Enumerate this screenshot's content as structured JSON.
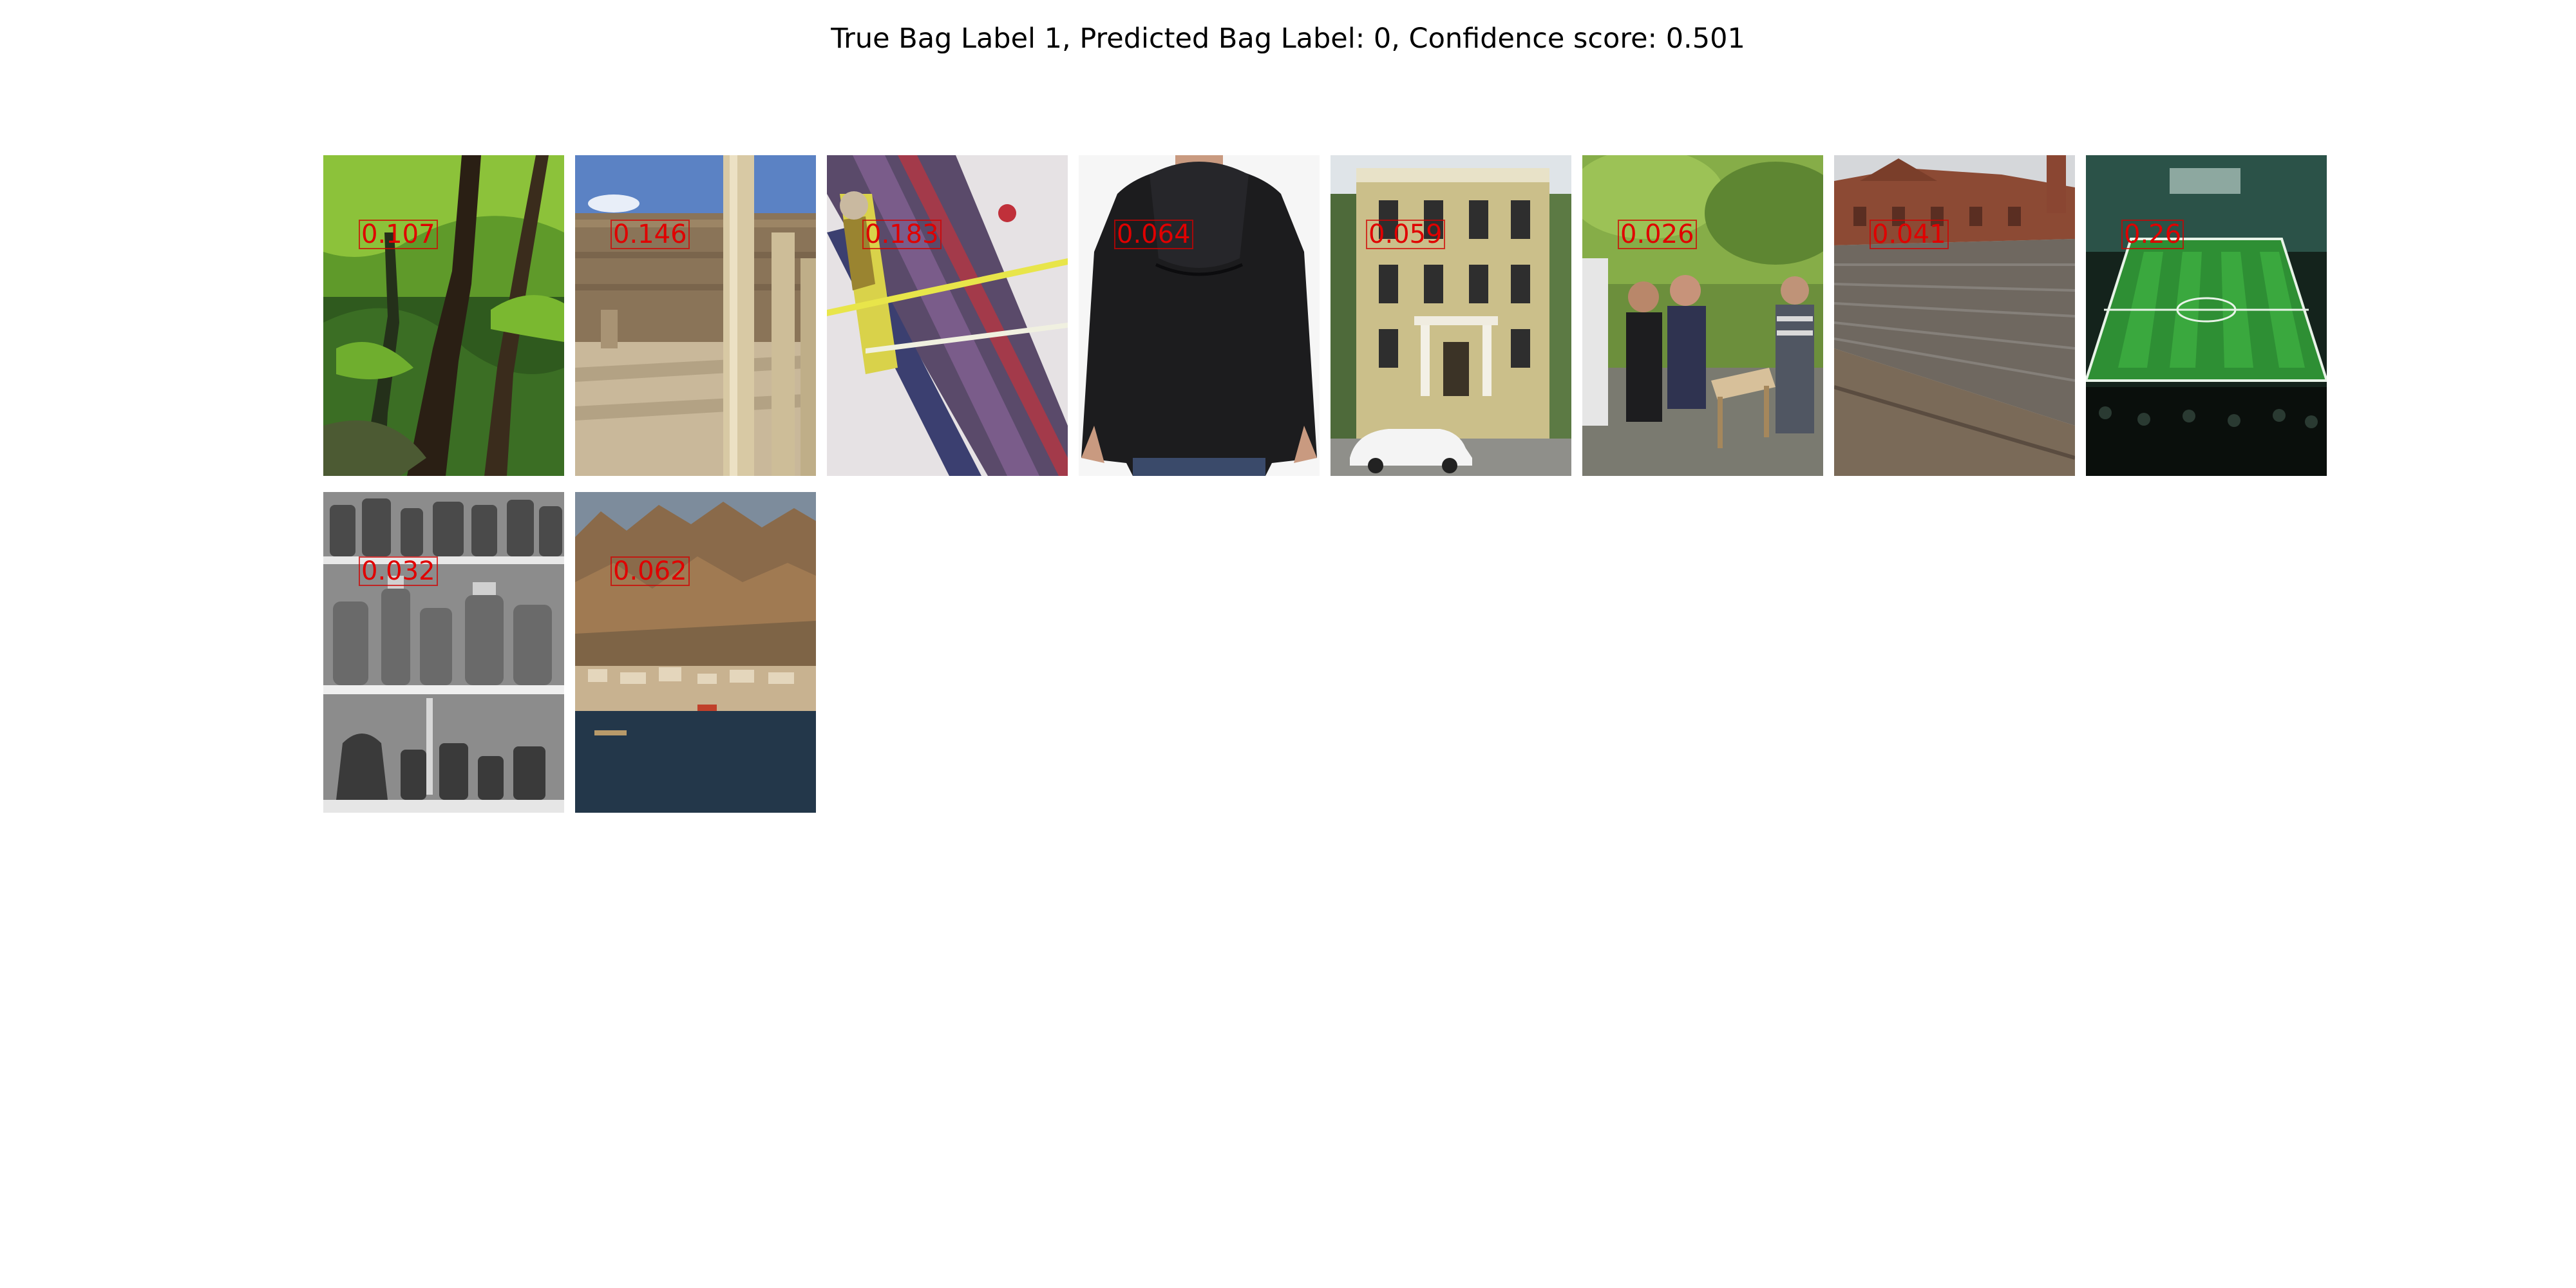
{
  "title": "True Bag Label 1, Predicted Bag Label: 0, Confidence score: 0.501",
  "colors": {
    "score_text": "#e00000",
    "score_box": "#d00000"
  },
  "instances": [
    {
      "score": "0.107",
      "icon": "forest-photo"
    },
    {
      "score": "0.146",
      "icon": "ruins-columns-photo"
    },
    {
      "score": "0.183",
      "icon": "graffiti-art-photo"
    },
    {
      "score": "0.064",
      "icon": "black-hoodie-photo"
    },
    {
      "score": "0.059",
      "icon": "townhouse-photo"
    },
    {
      "score": "0.026",
      "icon": "people-outdoors-photo"
    },
    {
      "score": "0.041",
      "icon": "brick-building-photo"
    },
    {
      "score": "0.26",
      "icon": "soccer-stadium-photo"
    },
    {
      "score": "0.032",
      "icon": "jars-shelves-photo"
    },
    {
      "score": "0.062",
      "icon": "coastal-town-photo"
    }
  ]
}
